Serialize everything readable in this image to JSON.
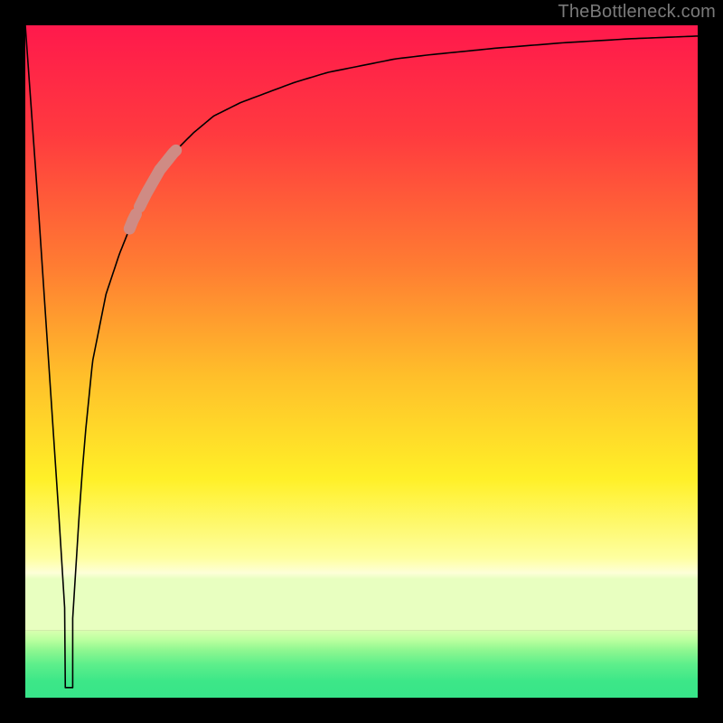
{
  "attribution": "TheBottleneck.com",
  "colors": {
    "curve": "#000000",
    "highlight": "#cf8b84",
    "gradient_bottom_band": "#37e489",
    "gradient_yellow": "#fff128",
    "gradient_orange": "#ff9a2a",
    "gradient_red": "#ff194c"
  },
  "chart_data": {
    "type": "line",
    "title": "",
    "xlabel": "",
    "ylabel": "",
    "xlim": [
      0,
      100
    ],
    "ylim": [
      0,
      100
    ],
    "notch_x": 6.5,
    "notch_floor_y": 1.5,
    "curve": {
      "x": [
        0,
        1,
        2,
        3,
        4,
        5,
        5.5,
        6,
        6.5,
        7,
        7.5,
        8,
        8.5,
        9,
        10,
        12,
        14,
        16,
        18,
        20,
        22,
        25,
        28,
        32,
        36,
        40,
        45,
        50,
        55,
        60,
        65,
        70,
        75,
        80,
        85,
        90,
        95,
        100
      ],
      "y": [
        100,
        86,
        72,
        57,
        42,
        27,
        19,
        11,
        1.5,
        11,
        19,
        27,
        34,
        40,
        50,
        60,
        66,
        71,
        75,
        78.5,
        81,
        84,
        86.5,
        88.5,
        90,
        91.5,
        93,
        94,
        95,
        95.6,
        96.1,
        96.6,
        97,
        97.4,
        97.7,
        98,
        98.2,
        98.4
      ]
    },
    "highlight_segments": [
      {
        "x0": 15.5,
        "x1": 16.5
      },
      {
        "x0": 17.0,
        "x1": 22.5
      }
    ],
    "green_band": {
      "y0": 0,
      "y1": 10
    }
  }
}
